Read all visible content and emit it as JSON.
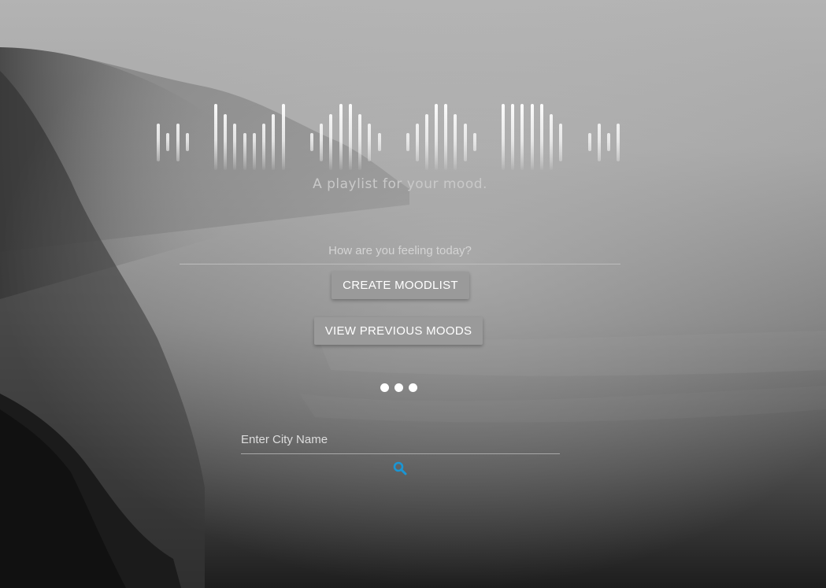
{
  "tagline": "A playlist for your mood.",
  "mood_input": {
    "placeholder": "How are you feeling today?",
    "value": ""
  },
  "buttons": {
    "create_label": "CREATE MOODLIST",
    "view_label": "VIEW PREVIOUS MOODS"
  },
  "city_input": {
    "placeholder": "Enter City Name",
    "value": ""
  },
  "icons": {
    "search": "search-icon",
    "carousel_dots": "dot"
  },
  "colors": {
    "accent": "#1a96d4",
    "button_bg": "#9a9a9a",
    "text_light": "#d4d4d4"
  }
}
